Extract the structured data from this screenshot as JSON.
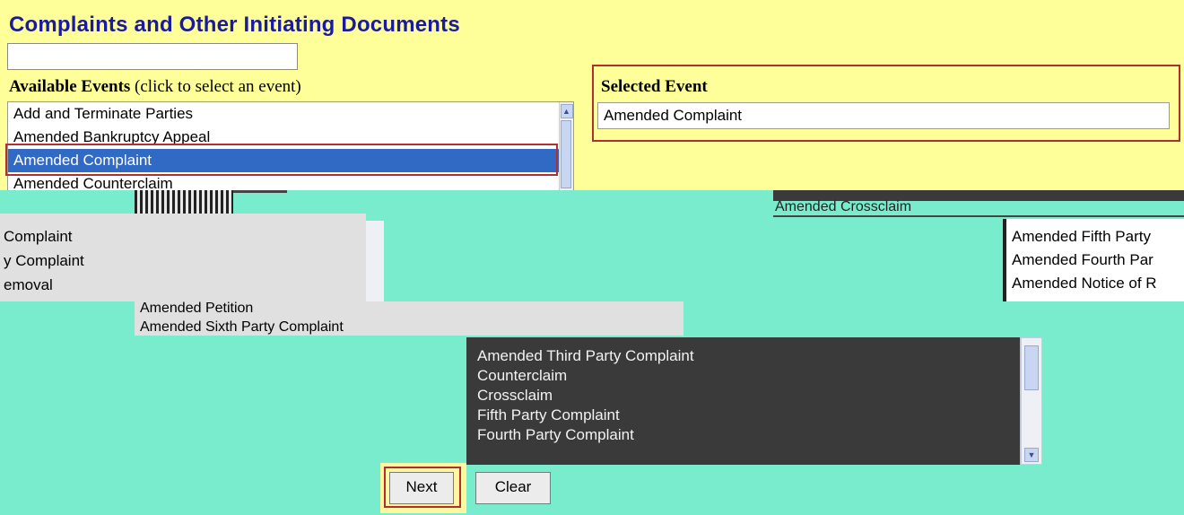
{
  "page": {
    "title": "Complaints and Other Initiating Documents",
    "search": {
      "value": "",
      "placeholder": ""
    }
  },
  "available_events": {
    "label_bold": "Available Events",
    "label_hint": "(click to select an event)",
    "items": [
      "Add and Terminate Parties",
      "Amended Bankruptcy Appeal",
      "Amended Complaint",
      "Amended Counterclaim"
    ],
    "selected_index": 2
  },
  "selected_event": {
    "label": "Selected Event",
    "value": "Amended Complaint"
  },
  "overlay_fragments": {
    "left_items": [
      "Complaint",
      "y Complaint",
      "emoval"
    ],
    "middle_items": [
      "Amended Petition",
      "Amended Sixth Party Complaint"
    ],
    "right_items": [
      "Amended Fifth Party",
      "Amended Fourth Par",
      "Amended Notice of R"
    ],
    "top_right_items": [
      "Amended Crossclaim"
    ]
  },
  "dark_list": {
    "items": [
      "Amended Third Party Complaint",
      "Counterclaim",
      "Crossclaim",
      "Fifth Party Complaint",
      "Fourth Party Complaint"
    ]
  },
  "buttons": {
    "next": "Next",
    "clear": "Clear"
  },
  "colors": {
    "title": "#1a1aa0",
    "background": "#ffff99",
    "selection": "#316ac5",
    "highlight_border": "#b03030",
    "overlay": "#79ecce"
  }
}
